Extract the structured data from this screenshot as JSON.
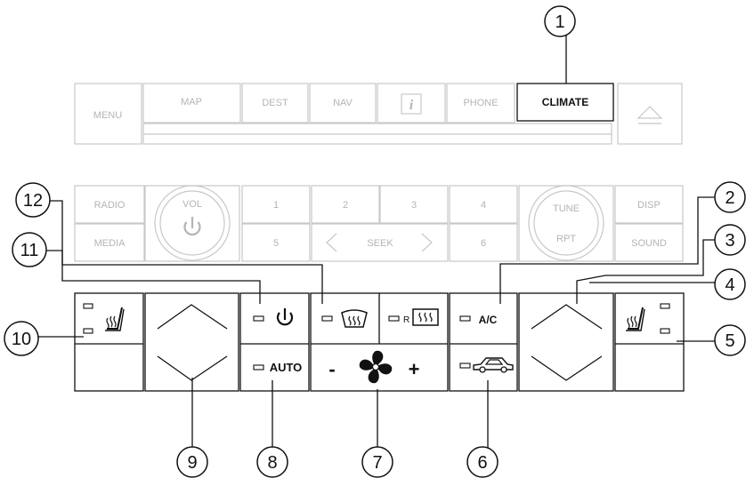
{
  "head_unit": {
    "top_row": {
      "menu": "MENU",
      "map": "MAP",
      "dest": "DEST",
      "nav": "NAV",
      "info": "i",
      "phone": "PHONE",
      "climate": "CLIMATE"
    },
    "audio_row": {
      "radio": "RADIO",
      "media": "MEDIA",
      "vol": "VOL",
      "preset_1": "1",
      "preset_2": "2",
      "preset_3": "3",
      "preset_4": "4",
      "preset_5": "5",
      "preset_6": "6",
      "seek": "SEEK",
      "tune": "TUNE",
      "rpt": "RPT",
      "disp": "DISP",
      "sound": "SOUND"
    }
  },
  "climate_panel": {
    "ac_label": "A/C",
    "auto_label": "AUTO",
    "fan_minus": "-",
    "fan_plus": "+",
    "rear_defrost_r": "R"
  },
  "callouts": [
    "1",
    "2",
    "3",
    "4",
    "5",
    "6",
    "7",
    "8",
    "9",
    "10",
    "11",
    "12"
  ]
}
